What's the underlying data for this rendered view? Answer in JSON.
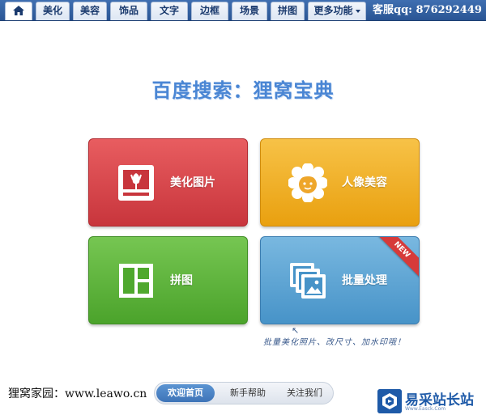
{
  "tabs": [
    {
      "key": "home",
      "label": ""
    },
    {
      "key": "beautify",
      "label": "美化"
    },
    {
      "key": "beauty",
      "label": "美容"
    },
    {
      "key": "accessories",
      "label": "饰品"
    },
    {
      "key": "text",
      "label": "文字"
    },
    {
      "key": "border",
      "label": "边框"
    },
    {
      "key": "scene",
      "label": "场景"
    },
    {
      "key": "collage",
      "label": "拼图"
    },
    {
      "key": "more",
      "label": "更多功能"
    }
  ],
  "service": "客服qq: 876292449",
  "headline": "百度搜索：狸窝宝典",
  "tiles": {
    "beautify": {
      "label": "美化图片",
      "color": "#d9474c"
    },
    "portrait": {
      "label": "人像美容",
      "color": "#f2b22f"
    },
    "collage": {
      "label": "拼图",
      "color": "#5db63b"
    },
    "batch": {
      "label": "批量处理",
      "color": "#5aa3d6",
      "ribbon": "NEW"
    }
  },
  "note": "批量美化照片、改尺寸、加水印哦！",
  "footer": {
    "site_label": "狸窝家园：www.leawo.cn",
    "nav": [
      "欢迎首页",
      "新手帮助",
      "关注我们"
    ]
  },
  "watermark": {
    "title": "易采站长站",
    "sub": "Www.Easck.Com"
  },
  "colors": {
    "topbar": "#2f5f9f",
    "headline": "#4a86d4",
    "active_pill": "#4a80c2"
  },
  "icons": [
    "home-icon",
    "tulip-photo-icon",
    "face-flower-icon",
    "grid-layout-icon",
    "photo-stack-icon",
    "caret-down-icon",
    "logo-icon"
  ]
}
